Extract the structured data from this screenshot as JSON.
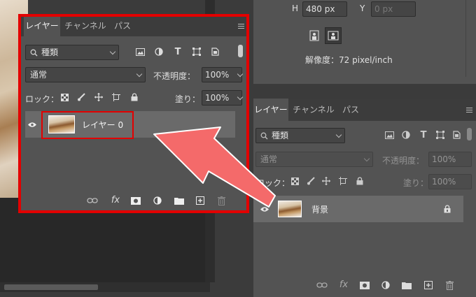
{
  "left_panel": {
    "tabs": [
      {
        "label": "レイヤー"
      },
      {
        "label": "チャンネル"
      },
      {
        "label": "パス"
      }
    ],
    "filter": {
      "value": "種類"
    },
    "blend_mode": "通常",
    "opacity_label": "不透明度：",
    "opacity_value": "100%",
    "lock_label": "ロック：",
    "fill_label": "塗り：",
    "fill_value": "100%",
    "layer": {
      "name": "レイヤー 0"
    }
  },
  "right_top": {
    "height_label": "H",
    "height_value": "480 px",
    "y_label": "Y",
    "y_placeholder": "0 px",
    "resolution": "解像度：72 pixel/inch"
  },
  "right_panel": {
    "tabs": [
      {
        "label": "レイヤー"
      },
      {
        "label": "チャンネル"
      },
      {
        "label": "パス"
      }
    ],
    "filter": {
      "value": "種類"
    },
    "blend_mode": "通常",
    "opacity_label": "不透明度：",
    "opacity_value": "100%",
    "lock_label": "ロック：",
    "fill_label": "塗り：",
    "fill_value": "100%",
    "layer": {
      "name": "背景"
    }
  },
  "colors": {
    "highlight": "#e30000",
    "arrow": "#f46a6a",
    "panel": "#535353"
  },
  "annotation_arrow": "pointing to layer thumbnail"
}
